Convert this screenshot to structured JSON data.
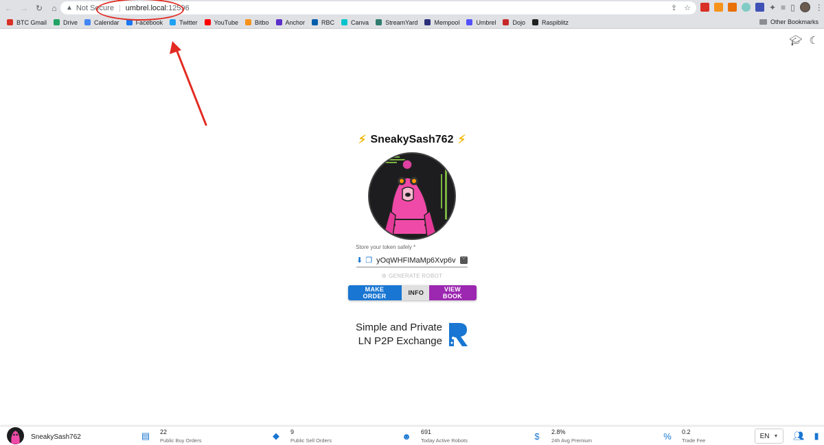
{
  "browser": {
    "security_label": "Not Secure",
    "url_host": "umbrel.local",
    "url_port": ":12596",
    "bookmarks": [
      {
        "label": "BTC Gmail",
        "color": "#d93025"
      },
      {
        "label": "Drive",
        "color": "#1fa463"
      },
      {
        "label": "Calendar",
        "color": "#4285f4"
      },
      {
        "label": "Facebook",
        "color": "#1877f2"
      },
      {
        "label": "Twitter",
        "color": "#1da1f2"
      },
      {
        "label": "YouTube",
        "color": "#ff0000"
      },
      {
        "label": "Bitbo",
        "color": "#f7931a"
      },
      {
        "label": "Anchor",
        "color": "#5b2fc9"
      },
      {
        "label": "RBC",
        "color": "#005daa"
      },
      {
        "label": "Canva",
        "color": "#00c4cc"
      },
      {
        "label": "StreamYard",
        "color": "#2e7d6f"
      },
      {
        "label": "Mempool",
        "color": "#2b2f7a"
      },
      {
        "label": "Umbrel",
        "color": "#5351fb"
      },
      {
        "label": "Dojo",
        "color": "#c62828"
      },
      {
        "label": "Raspiblitz",
        "color": "#222222"
      }
    ],
    "other_bookmarks": "Other Bookmarks"
  },
  "robot": {
    "nickname": "SneakySash762",
    "token_label": "Store your token safely *",
    "token_value": "yOqWHFIMaMp6Xvp6v",
    "generate_label": "GENERATE ROBOT"
  },
  "actions": {
    "make_order": "MAKE ORDER",
    "info": "INFO",
    "view_book": "VIEW BOOK"
  },
  "tagline": {
    "line1": "Simple and Private",
    "line2": "LN P2P Exchange"
  },
  "stats": {
    "nickname": "SneakySash762",
    "buy_orders_value": "22",
    "buy_orders_label": "Public Buy Orders",
    "sell_orders_value": "9",
    "sell_orders_label": "Public Sell Orders",
    "robots_value": "691",
    "robots_label": "Today Active Robots",
    "premium_value": "2.8%",
    "premium_label": "24h Avg Premium",
    "fee_value": "0.2",
    "fee_label": "Trade Fee",
    "language": "EN"
  },
  "colors": {
    "primary": "#1976d2",
    "secondary": "#9c27b0",
    "annotation": "#e22b22"
  }
}
